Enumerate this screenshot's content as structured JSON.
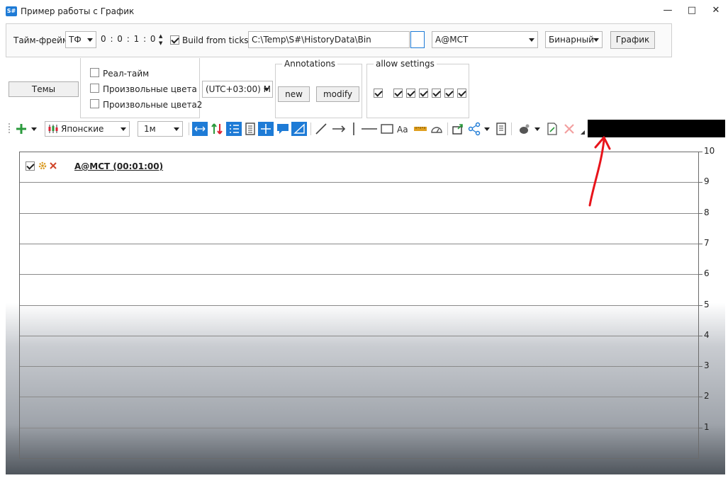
{
  "window": {
    "title": "Пример работы с График",
    "app_icon": "S#",
    "minimize": "—",
    "maximize": "□",
    "close": "✕"
  },
  "settings": {
    "timeframe_label": "Тайм-фрейм",
    "timeframe_type": "ТФ",
    "timeframe_value": "0 : 0 : 1 : 0",
    "build_from_ticks": "Build from ticks",
    "path": "C:\\Temp\\S#\\HistoryData\\Bin",
    "security": "A@MCT",
    "format": "Бинарный",
    "chart_button": "График",
    "themes_button": "Темы",
    "realtime": "Реал-тайм",
    "custom_colors": "Произвольные цвета",
    "custom_colors2": "Произвольные цвета2",
    "timezone": "(UTC+03:00) M",
    "annotations_title": "Annotations",
    "annotations_new": "new",
    "annotations_modify": "modify",
    "allow_settings_title": "allow settings"
  },
  "toolbar": {
    "chart_style": "Японские",
    "period": "1м"
  },
  "chart": {
    "legend_title": "A@MCT (00:01:00)",
    "y_ticks": [
      "10",
      "9",
      "8",
      "7",
      "6",
      "5",
      "4",
      "3",
      "2",
      "1"
    ],
    "accent_color": "#1e7bd6",
    "arrow_color": "#e8141b"
  }
}
